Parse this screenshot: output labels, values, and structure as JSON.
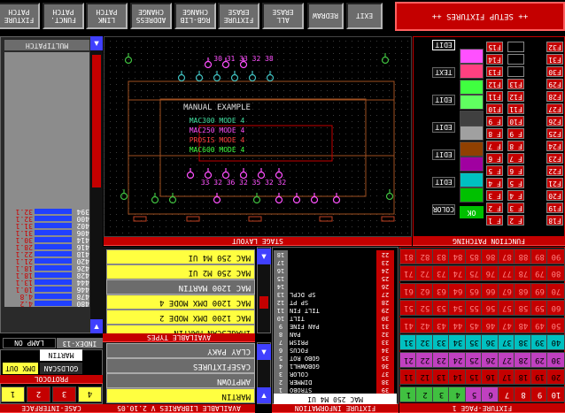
{
  "top_buttons": [
    {
      "label": "FIXTURE\nPATCH"
    },
    {
      "label": "FUNCT.\nPATCH"
    },
    {
      "label": "LINK\nPATCH"
    },
    {
      "label": "ADDRESS\nCHANGE"
    },
    {
      "label": "RGB-LIB\nCHANGE"
    },
    {
      "label": "FIXTURE\nERASE"
    },
    {
      "label": "ALL\nERASE"
    },
    {
      "label": "REDRAW"
    },
    {
      "label": "EXIT"
    }
  ],
  "setup_title": "++ SETUP FIXTURES ++",
  "multipatch": {
    "title": "MULTIPATCH",
    "rows": [
      {
        "l": "4.2",
        "r": "480"
      },
      {
        "l": "4.8",
        "r": "478"
      },
      {
        "l": "10.1",
        "r": "446"
      },
      {
        "l": "13.1",
        "r": "444"
      },
      {
        "l": "18.1",
        "r": "428"
      },
      {
        "l": "18.1",
        "r": "426"
      },
      {
        "l": "21.1",
        "r": "420"
      },
      {
        "l": "22.1",
        "r": "418"
      },
      {
        "l": "28.1",
        "r": "416"
      },
      {
        "l": "30.1",
        "r": "414"
      },
      {
        "l": "31.1",
        "r": "406"
      },
      {
        "l": "31.1",
        "r": "402"
      },
      {
        "l": "32.1",
        "r": "400"
      },
      {
        "l": "32.1",
        "r": "394"
      }
    ],
    "lamp_label": "LAMP ON",
    "index_label": "INDEX-13"
  },
  "protocol": {
    "dmx_out": "DMX OUT",
    "goldscan": "GOLDSCAN",
    "martin": "MARTIN",
    "title": "PROTOCOL",
    "nums": [
      "1",
      "2",
      "3",
      "4"
    ],
    "footer": "CASE-INTERFACE"
  },
  "stage": {
    "title": "STAGE LAYOUT",
    "manual": "MANUAL EXAMPLE",
    "modes": [
      {
        "text": "MAC300 MODE 4",
        "color": "#40e0a0"
      },
      {
        "text": "MAC250 MODE 4",
        "color": "#ff50ff"
      },
      {
        "text": "PROSIS MODE 4",
        "color": "#ff4040"
      },
      {
        "text": "MAC600 MODE 4",
        "color": "#40ff40"
      }
    ],
    "top_nums": "30 31 33 32 38",
    "bottom_nums": "33 32 36 32 35 32 32"
  },
  "types": {
    "title": "AVAILABLE TYPES",
    "rows": [
      {
        "label": "MAC 250 M4 UI",
        "sel": true
      },
      {
        "label": "MAC 250 M2 UI",
        "sel": true
      },
      {
        "label": "MAC 1200 MARTIN",
        "sel": false
      },
      {
        "label": "MAC 1200 DMX MODE 4",
        "sel": true
      },
      {
        "label": "MAC 1200 DMX MODE 2",
        "sel": true
      },
      {
        "label": "IMAGESCAN MARTIN",
        "sel": true
      }
    ]
  },
  "libraries": {
    "title": "AVAILABLE LIBRARIES V 2.10.05",
    "rows": [
      {
        "label": "CLAY PAKY"
      },
      {
        "label": "CASEFIXTURES"
      },
      {
        "label": "AMPTOWN"
      },
      {
        "label": "MARTIN",
        "sel": true
      }
    ]
  },
  "fixture_info": {
    "title": "FIXTURE INFORMATION",
    "name": "MAC 250 M4 UI",
    "rows": [
      {
        "n": "1",
        "t": "STROBO",
        "v": "39"
      },
      {
        "n": "2",
        "t": "DIMMER",
        "v": "38"
      },
      {
        "n": "3",
        "t": "COLOR",
        "v": "37"
      },
      {
        "n": "4",
        "t": "GOBOWHL1",
        "v": "36"
      },
      {
        "n": "5",
        "t": "GOBO ROT",
        "v": "35"
      },
      {
        "n": "6",
        "t": "FOCUS",
        "v": "34"
      },
      {
        "n": "7",
        "t": "PRISM",
        "v": "33"
      },
      {
        "n": "8",
        "t": "PAN",
        "v": "32"
      },
      {
        "n": "9",
        "t": "PAN FINE",
        "v": "31"
      },
      {
        "n": "10",
        "t": "TILT",
        "v": "30"
      },
      {
        "n": "11",
        "t": "TILT FIN",
        "v": "29"
      },
      {
        "n": "12",
        "t": "SP PT",
        "v": "28"
      },
      {
        "n": "13",
        "t": "SP DCPL",
        "v": "27"
      },
      {
        "n": "14",
        "t": "",
        "v": "26"
      },
      {
        "n": "15",
        "t": "",
        "v": "25"
      },
      {
        "n": "16",
        "t": "",
        "v": "24"
      },
      {
        "n": "17",
        "t": "",
        "v": "23"
      },
      {
        "n": "18",
        "t": "",
        "v": "22"
      }
    ]
  },
  "function_patching": {
    "title": "FUNCTION PATCHING",
    "edit_labels": [
      "EDIT",
      "TEXT",
      "EDIT",
      "EDIT",
      "EDIT",
      "EDIT",
      "COLOR"
    ],
    "colors": [
      "#ff50ff",
      "#ff4080",
      "#40ff40",
      "#60ff60",
      "#404040",
      "#a0a0a0",
      "#904000",
      "#a000a0",
      "#00c0c0",
      "#00c000"
    ],
    "ok_label": "OK",
    "col_a": [
      "F15",
      "F14",
      "F13",
      "F12",
      "F11",
      "F10",
      "F 9",
      "F 8",
      "F 7",
      "F 6",
      "F 5",
      "F 4",
      "F 3",
      "F 2",
      "F 1"
    ],
    "col_b": [
      "",
      "",
      "",
      "F13",
      "F12",
      "F11",
      "F10",
      "F 9",
      "F 8",
      "F 7",
      "F 6",
      "F 5",
      "F 4",
      "F 3",
      "F 2"
    ],
    "col_c": [
      "F32",
      "F31",
      "F30",
      "F29",
      "F28",
      "F27",
      "F26",
      "F25",
      "F24",
      "F23",
      "F22",
      "F21",
      "F20",
      "F19",
      "F18"
    ]
  },
  "fixture_page": {
    "title": "FIXTURE-PAGE 1",
    "rows": [
      [
        "1",
        "2",
        "3",
        "4",
        "5",
        "6",
        "7",
        "8",
        "9",
        "10"
      ],
      [
        "11",
        "12",
        "13",
        "14",
        "15",
        "16",
        "17",
        "18",
        "19",
        "20"
      ],
      [
        "21",
        "22",
        "23",
        "24",
        "25",
        "26",
        "27",
        "28",
        "29",
        "30"
      ],
      [
        "31",
        "32",
        "33",
        "34",
        "35",
        "36",
        "37",
        "38",
        "39",
        "40"
      ],
      [
        "41",
        "42",
        "43",
        "44",
        "45",
        "46",
        "47",
        "48",
        "49",
        "50"
      ],
      [
        "51",
        "52",
        "53",
        "54",
        "55",
        "56",
        "57",
        "58",
        "59",
        "60"
      ],
      [
        "61",
        "62",
        "63",
        "64",
        "65",
        "66",
        "67",
        "68",
        "69",
        "70"
      ],
      [
        "71",
        "72",
        "73",
        "74",
        "75",
        "76",
        "77",
        "78",
        "79",
        "80"
      ],
      [
        "81",
        "82",
        "83",
        "84",
        "85",
        "86",
        "87",
        "88",
        "89",
        "90"
      ]
    ]
  }
}
